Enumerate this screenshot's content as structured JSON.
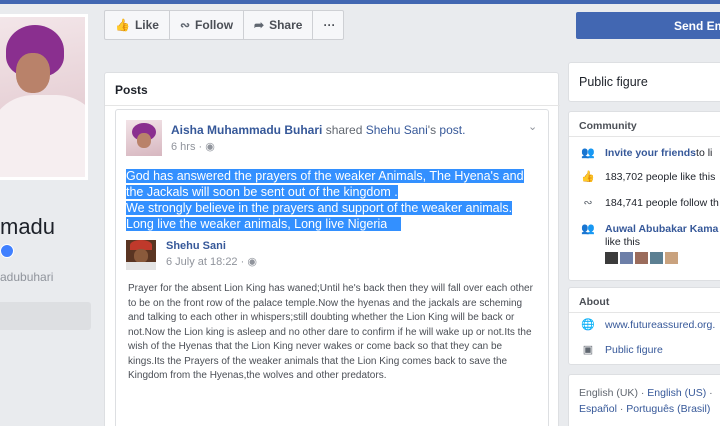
{
  "profile": {
    "name_partial": "madu",
    "handle_partial": "adubuhari"
  },
  "actions": {
    "like": "Like",
    "follow": "Follow",
    "share": "Share",
    "more": "···"
  },
  "posts": {
    "title": "Posts",
    "post": {
      "author": "Aisha Muhammadu Buhari",
      "verb": " shared ",
      "shared_author": "Shehu Sani",
      "suffix": "'s ",
      "link": "post.",
      "time": "6 hrs · ",
      "text_line1": "God has answered the prayers of the weaker Animals, The Hyena's and",
      "text_line2": "the Jackals will soon be sent out of the kingdom .",
      "text_line3": "We strongly believe in the prayers and support of the weaker animals.",
      "text_line4": "Long live the weaker animals, Long live Nigeria",
      "shared": {
        "author": "Shehu Sani",
        "time": "6 July at 18:22 · ",
        "body": "Prayer for the absent Lion King has waned;Until he's back then they will fall over each other to be on the front row of the palace temple.Now the hyenas and the jackals are scheming and talking to each other in whispers;still doubting whether the Lion King will be back or not.Now the Lion king is asleep and no other dare to confirm if he will wake up or not.Its the wish of the Hyenas that the Lion King never wakes or come back so that they can be kings.Its the Prayers of the weaker animals that the Lion King comes back to save the Kingdom from the Hyenas,the wolves and other predators."
      }
    }
  },
  "right": {
    "send_button": "Send Em",
    "public_figure": "Public figure",
    "community": {
      "title": "Community",
      "invite": "Invite your friends",
      "invite_suffix": " to li",
      "likes": "183,702 people like this",
      "follows": "184,741 people follow th",
      "friend_name": "Auwal Abubakar Kama",
      "friend_suffix": "like this"
    },
    "about": {
      "title": "About",
      "website": "www.futureassured.org.",
      "category": "Public figure"
    },
    "languages": {
      "current": "English (UK)",
      "sep1": " · ",
      "us": "English (US)",
      "sep2": " · ",
      "es": "Español",
      "sep3": " · ",
      "pt": "Português (Brasil)"
    }
  },
  "colors": {
    "brand": "#4267b2",
    "link": "#365899",
    "selection": "#3390ff"
  }
}
